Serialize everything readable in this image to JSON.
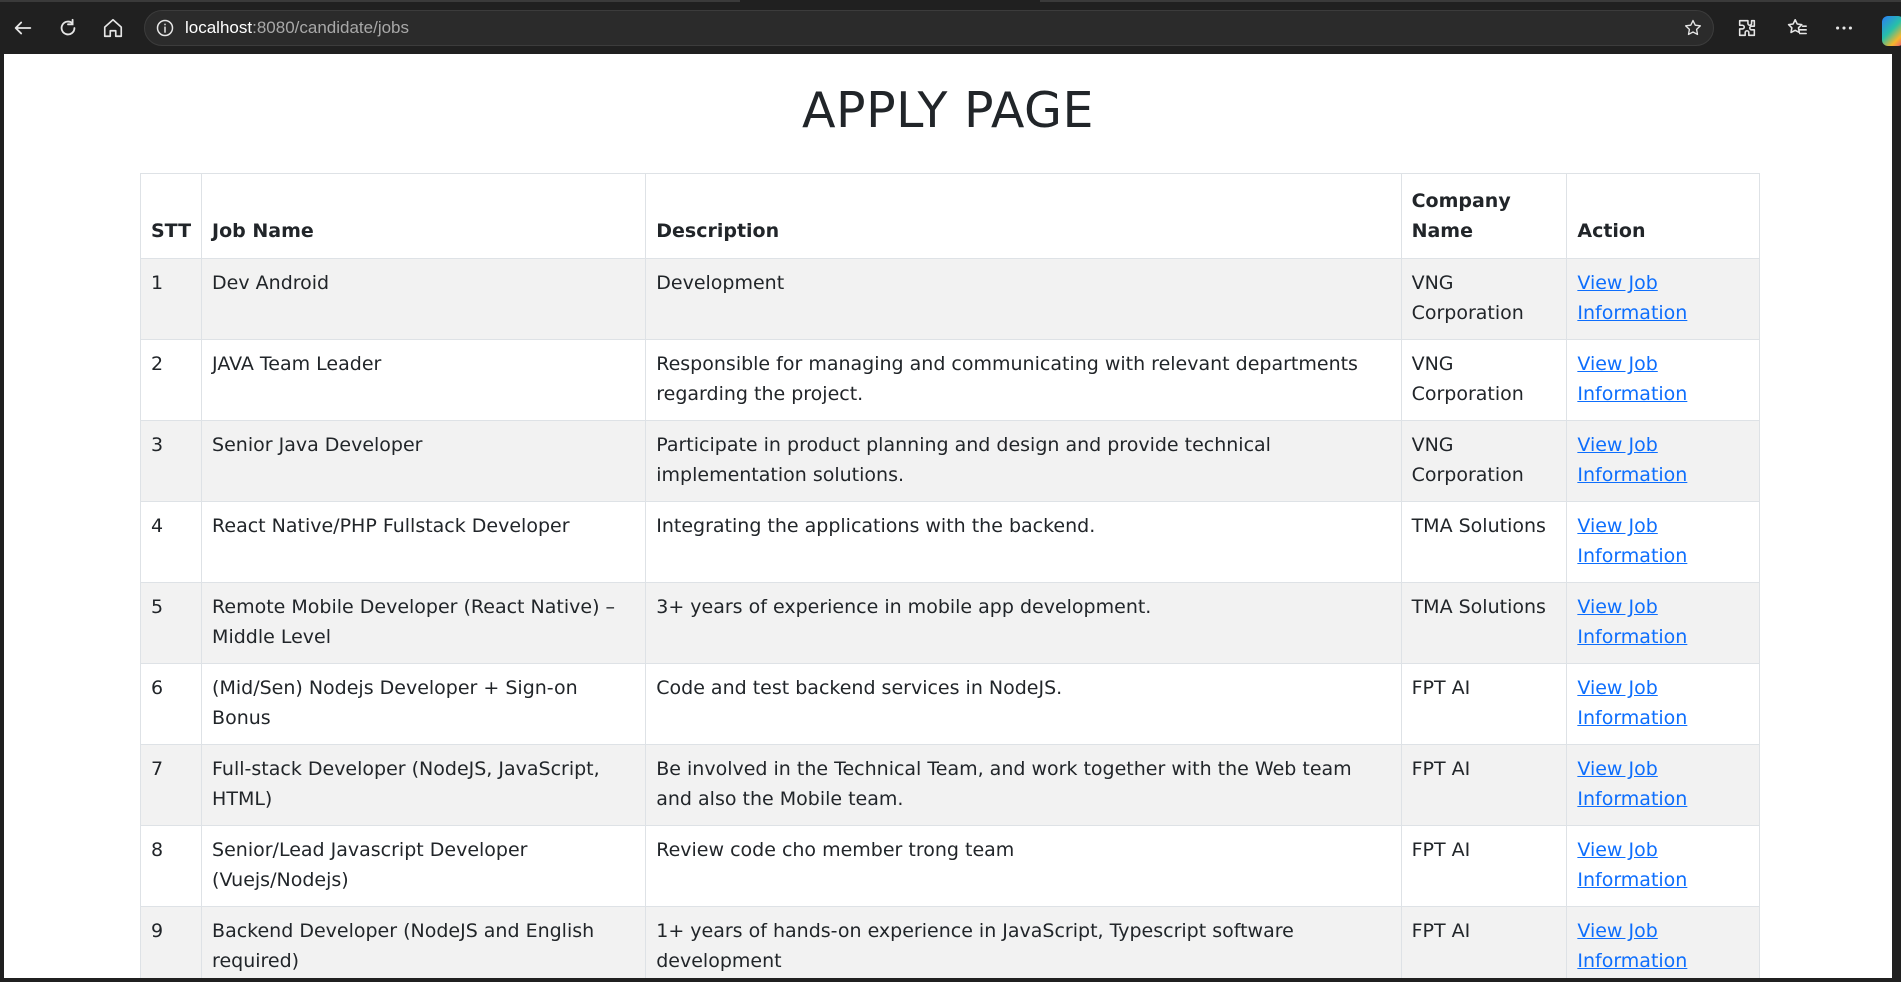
{
  "browser": {
    "url_host": "localhost",
    "url_path": ":8080/candidate/jobs"
  },
  "page": {
    "title": "APPLY PAGE"
  },
  "table": {
    "headers": {
      "stt": "STT",
      "job_name": "Job Name",
      "description": "Description",
      "company": "Company Name",
      "action": "Action"
    },
    "rows": [
      {
        "stt": "1",
        "job_name": "Dev Android",
        "description": "Development",
        "company": "VNG Corporation",
        "action": "View Job Information"
      },
      {
        "stt": "2",
        "job_name": "JAVA Team Leader",
        "description": "Responsible for managing and communicating with relevant departments regarding the project.",
        "company": "VNG Corporation",
        "action": "View Job Information"
      },
      {
        "stt": "3",
        "job_name": "Senior Java Developer",
        "description": "Participate in product planning and design and provide technical implementation solutions.",
        "company": "VNG Corporation",
        "action": "View Job Information"
      },
      {
        "stt": "4",
        "job_name": "React Native/PHP Fullstack Developer",
        "description": "Integrating the applications with the backend.",
        "company": "TMA Solutions",
        "action": "View Job Information"
      },
      {
        "stt": "5",
        "job_name": "Remote Mobile Developer (React Native) – Middle Level",
        "description": "3+ years of experience in mobile app development.",
        "company": "TMA Solutions",
        "action": "View Job Information"
      },
      {
        "stt": "6",
        "job_name": "(Mid/Sen) Nodejs Developer + Sign-on Bonus",
        "description": "Code and test backend services in NodeJS.",
        "company": "FPT AI",
        "action": "View Job Information"
      },
      {
        "stt": "7",
        "job_name": "Full-stack Developer (NodeJS, JavaScript, HTML)",
        "description": "Be involved in the Technical Team, and work together with the Web team and also the Mobile team.",
        "company": "FPT AI",
        "action": "View Job Information"
      },
      {
        "stt": "8",
        "job_name": "Senior/Lead Javascript Developer (Vuejs/Nodejs)",
        "description": "Review code cho member trong team",
        "company": "FPT AI",
        "action": "View Job Information"
      },
      {
        "stt": "9",
        "job_name": "Backend Developer (NodeJS and English required)",
        "description": "1+ years of hands-on experience in JavaScript, Typescript software development",
        "company": "FPT AI",
        "action": "View Job Information"
      }
    ]
  }
}
